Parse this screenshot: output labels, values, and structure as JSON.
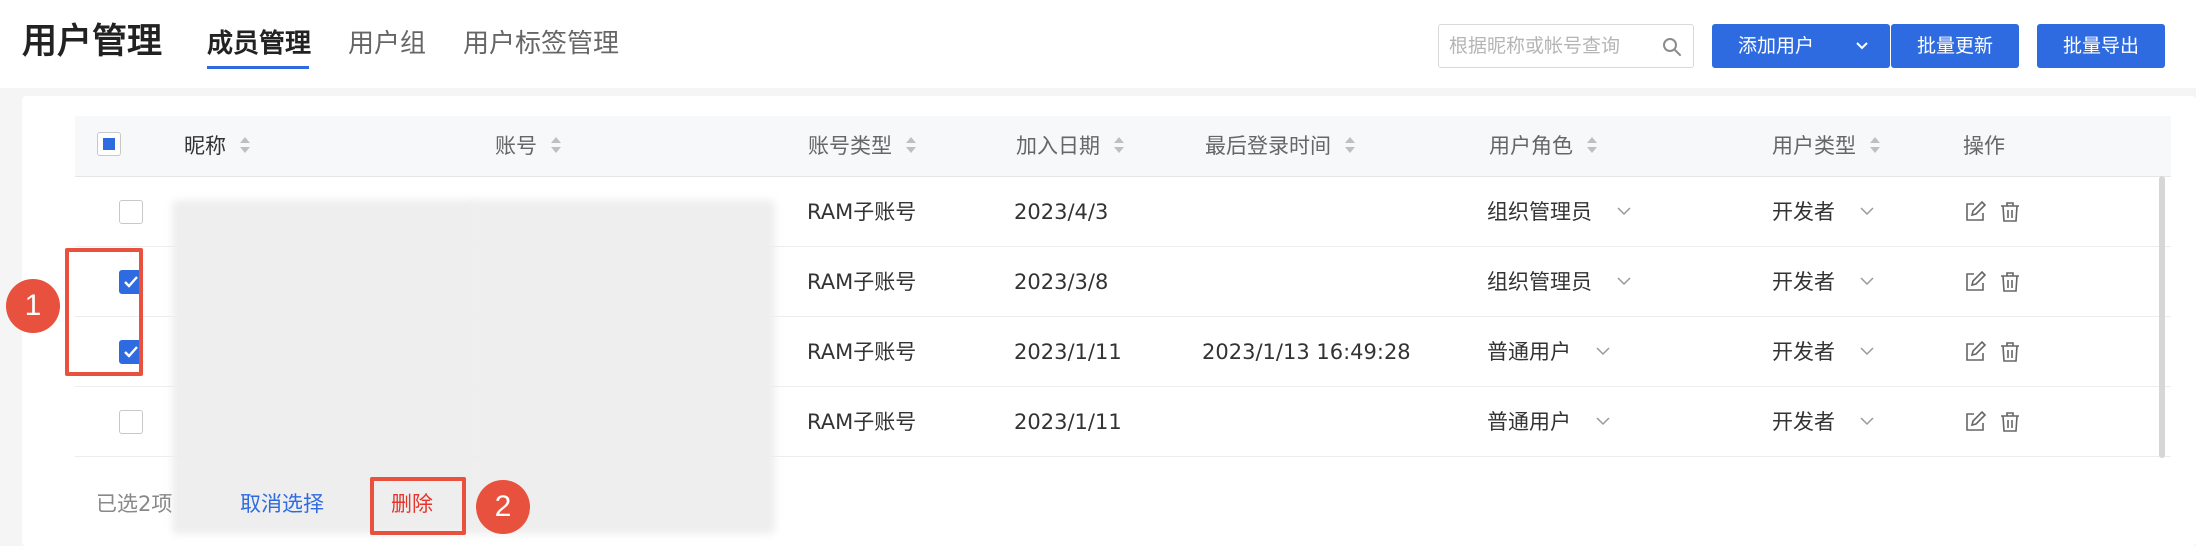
{
  "header": {
    "title": "用户管理",
    "tabs": [
      {
        "label": "成员管理",
        "active": true
      },
      {
        "label": "用户组",
        "active": false
      },
      {
        "label": "用户标签管理",
        "active": false
      }
    ],
    "search": {
      "placeholder": "根据昵称或帐号查询",
      "icon": "search-icon"
    },
    "buttons": {
      "add_user": "添加用户",
      "batch_update": "批量更新",
      "batch_export": "批量导出"
    }
  },
  "table": {
    "columns": [
      "昵称",
      "账号",
      "账号类型",
      "加入日期",
      "最后登录时间",
      "用户角色",
      "用户类型",
      "操作"
    ],
    "rows": [
      {
        "checked": false,
        "account_type": "RAM子账号",
        "join_date": "2023/4/3",
        "last_login": "",
        "role": "组织管理员",
        "user_type": "开发者"
      },
      {
        "checked": true,
        "account_type": "RAM子账号",
        "join_date": "2023/3/8",
        "last_login": "",
        "role": "组织管理员",
        "user_type": "开发者"
      },
      {
        "checked": true,
        "account_type": "RAM子账号",
        "join_date": "2023/1/11",
        "last_login": "2023/1/13 16:49:28",
        "role": "普通用户",
        "user_type": "开发者"
      },
      {
        "checked": false,
        "account_type": "RAM子账号",
        "join_date": "2023/1/11",
        "last_login": "",
        "role": "普通用户",
        "user_type": "开发者"
      }
    ]
  },
  "footer": {
    "selected_count": "已选2项",
    "cancel_label": "取消选择",
    "delete_label": "删除"
  },
  "annotations": {
    "badge_1": "1",
    "badge_2": "2"
  },
  "colors": {
    "accent": "#2f6be0",
    "danger": "#e5352b",
    "annotation": "#e8513d"
  }
}
